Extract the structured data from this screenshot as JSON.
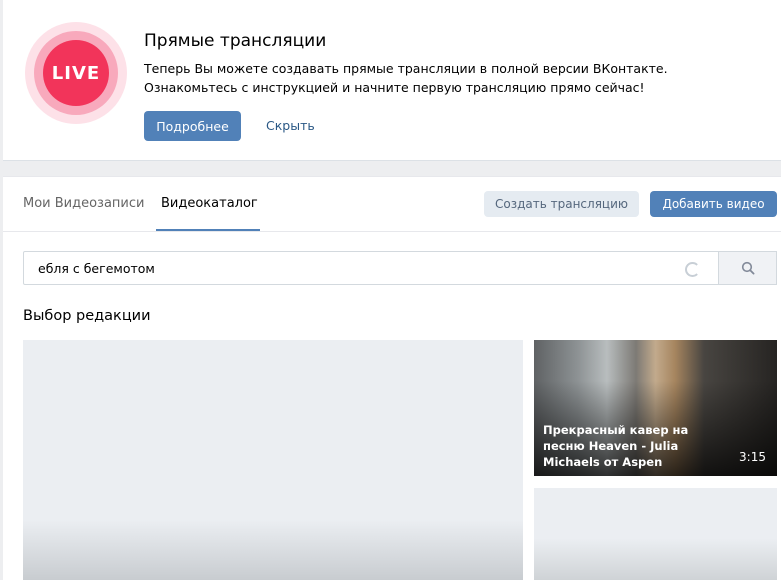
{
  "promo": {
    "badge": "LIVE",
    "title": "Прямые трансляции",
    "text_line1": "Теперь Вы можете создавать прямые трансляции в полной версии ВКонтакте.",
    "text_line2": "Ознакомьтесь с инструкцией и начните первую трансляцию прямо сейчас!",
    "more_button": "Подробнее",
    "hide_link": "Скрыть"
  },
  "video": {
    "tabs": [
      {
        "label": "Мои Видеозаписи",
        "active": false
      },
      {
        "label": "Видеокаталог",
        "active": true
      }
    ],
    "create_stream_button": "Создать трансляцию",
    "add_video_button": "Добавить видео",
    "search": {
      "value": "ебля с бегемотом"
    },
    "section_title": "Выбор редакции",
    "featured_video": {
      "title": "Прекрасный кавер на песню Heaven - Julia Michaels от Aspen",
      "duration": "3:15"
    }
  },
  "colors": {
    "accent": "#5181b8",
    "live_red": "#f2345a",
    "page_bg": "#edeef0"
  },
  "icons": [
    "live-badge-icon",
    "spinner-icon",
    "search-icon"
  ]
}
